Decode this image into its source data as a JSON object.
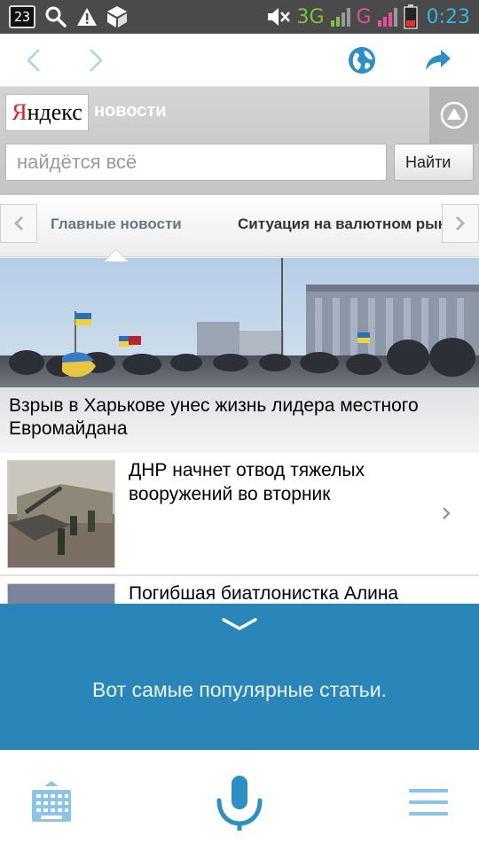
{
  "status_bar": {
    "calendar_day": "23",
    "network_3g": "3G",
    "network_g": "G",
    "time": "0:23",
    "icons": [
      "calendar-icon",
      "search-icon",
      "warning-icon",
      "package-icon",
      "mute-icon",
      "signal-icon",
      "battery-icon"
    ]
  },
  "toolbar": {
    "icons": [
      "back-icon",
      "forward-icon",
      "globe-icon",
      "share-icon"
    ]
  },
  "yandex": {
    "logo_first": "Я",
    "logo_rest": "ндекс",
    "section": "новости",
    "search_placeholder": "найдётся всё",
    "search_button": "Найти"
  },
  "tabs": [
    {
      "label": "Главные новости",
      "active": true
    },
    {
      "label": "Ситуация на валютном рынке",
      "active": false
    }
  ],
  "hero": {
    "caption": "Взрыв в Харькове унес жизнь лидера местного Евромайдана"
  },
  "news": [
    {
      "title": "ДНР начнет отвод тяжелых вооружений во вторник"
    },
    {
      "title": "Погибшая биатлонистка Алина"
    }
  ],
  "assistant": {
    "message": "Вот самые популярные статьи."
  },
  "bottom_bar": {
    "icons": [
      "keyboard-icon",
      "microphone-icon",
      "menu-icon"
    ]
  },
  "colors": {
    "accent": "#33b5e5",
    "panel": "#2a86b9",
    "icon_blue": "#2e8fc6"
  }
}
